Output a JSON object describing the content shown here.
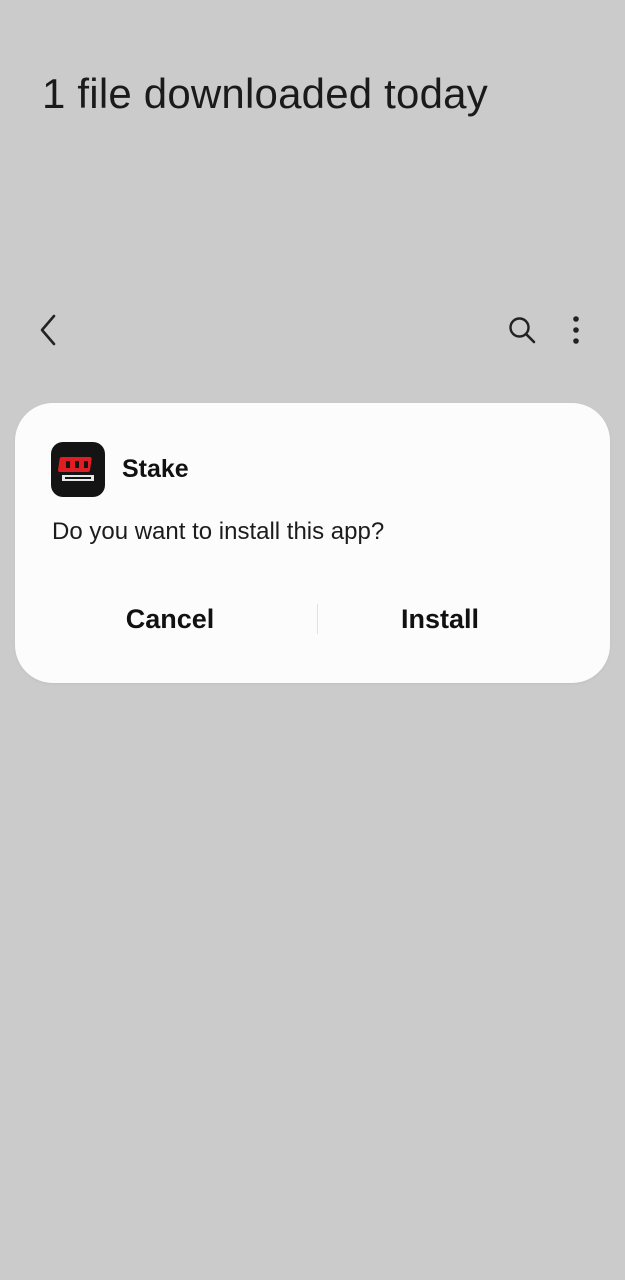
{
  "header": {
    "title": "1 file downloaded today"
  },
  "appbar": {
    "back_icon": "chevron-left-icon",
    "search_icon": "search-icon",
    "more_icon": "more-vertical-icon"
  },
  "dialog": {
    "app_name": "Stake",
    "app_icon": "app-logo-icon",
    "message": "Do you want to install this app?",
    "cancel_label": "Cancel",
    "install_label": "Install"
  },
  "colors": {
    "background": "#cbcbcb",
    "dialog_background": "#fcfcfd",
    "icon_background": "#141414",
    "icon_accent": "#e01d22"
  }
}
